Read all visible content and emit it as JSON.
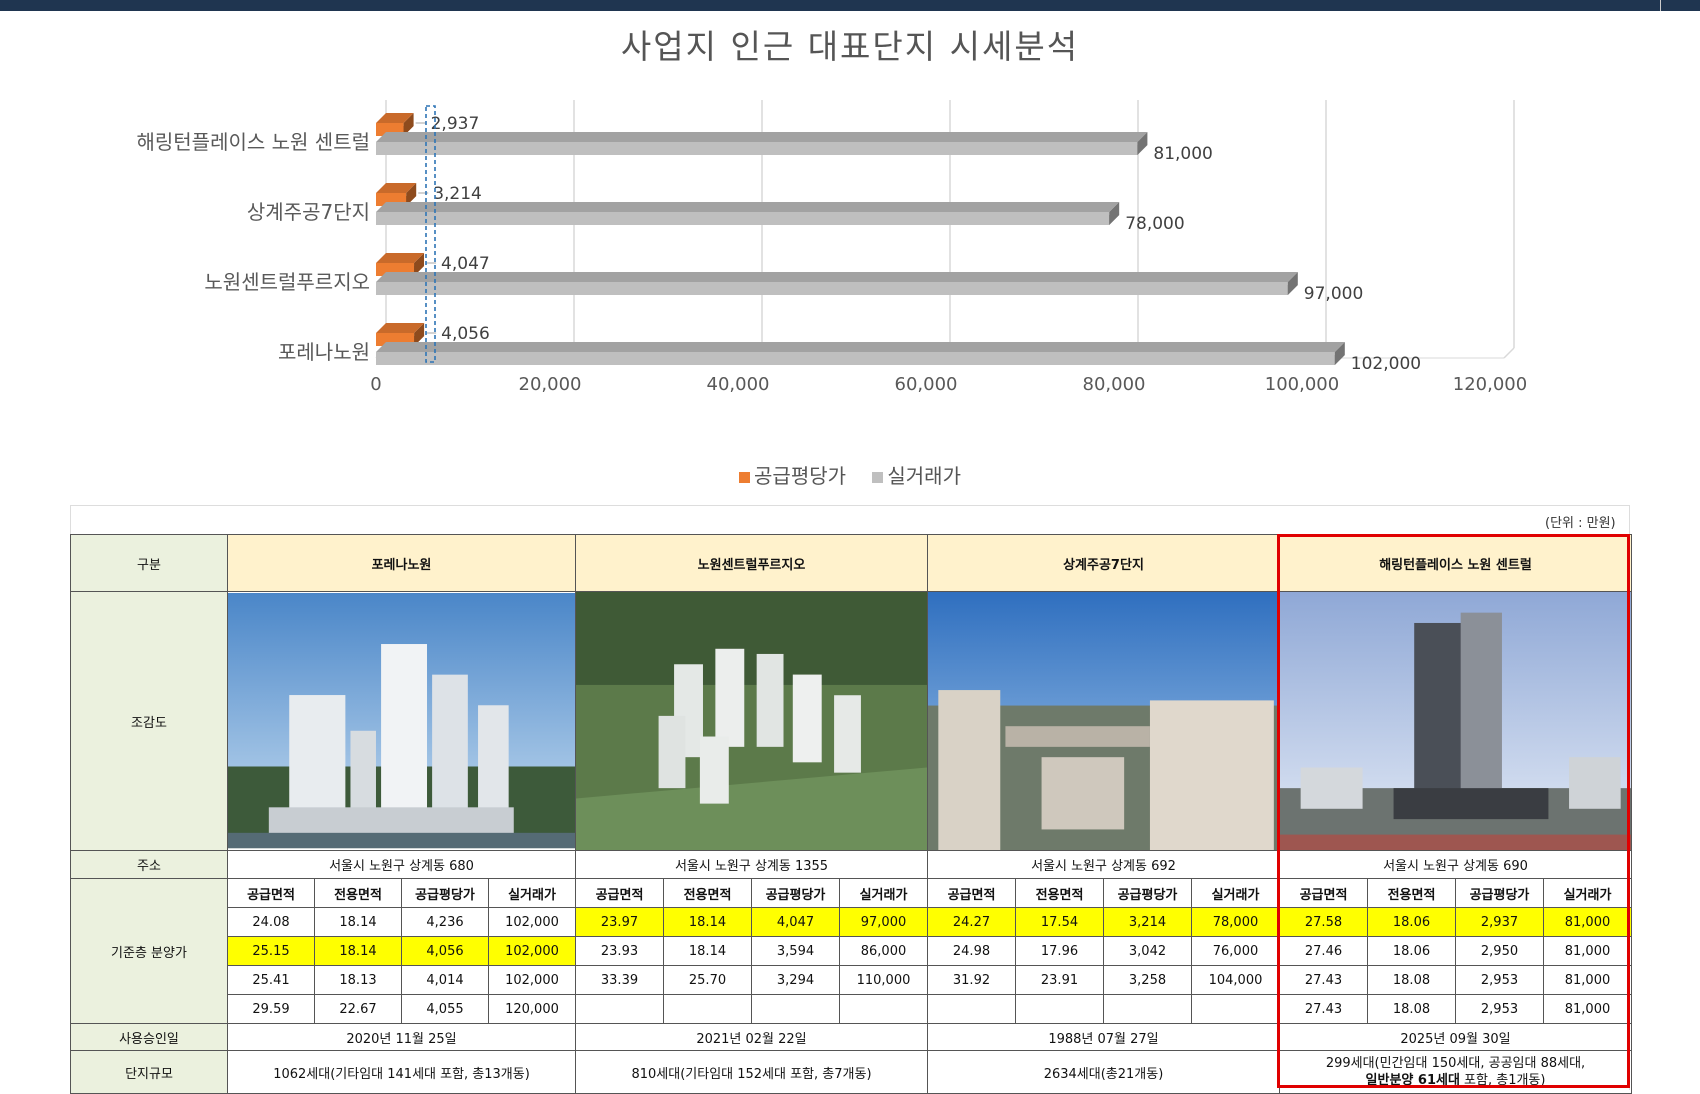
{
  "colors": {
    "supply": "#ed7d31",
    "actual": "#bfbfbf",
    "highlight": "#ffff00",
    "row_header": "#ebf1de",
    "col_header": "#fff2cc",
    "red_box": "#e00000"
  },
  "chart_data": {
    "type": "bar",
    "orientation": "horizontal",
    "title": "사업지 인근 대표단지 시세분석",
    "categories": [
      "해링턴플레이스 노원 센트럴",
      "상계주공7단지",
      "노원센트럴푸르지오",
      "포레나노원"
    ],
    "series": [
      {
        "name": "공급평당가",
        "values": [
          2937,
          3214,
          4047,
          4056
        ],
        "labels": [
          "2,937",
          "3,214",
          "4,047",
          "4,056"
        ]
      },
      {
        "name": "실거래가",
        "values": [
          81000,
          78000,
          97000,
          102000
        ],
        "labels": [
          "81,000",
          "78,000",
          "97,000",
          "102,000"
        ]
      }
    ],
    "xlim": [
      0,
      120000
    ],
    "xticks": [
      0,
      20000,
      40000,
      60000,
      80000,
      100000,
      120000
    ],
    "xtick_labels": [
      "0",
      "20,000",
      "40,000",
      "60,000",
      "80,000",
      "100,000",
      "120,000"
    ],
    "grid": true,
    "legend": "bottom"
  },
  "table": {
    "unit": "(단위 : 만원)",
    "row_labels": {
      "category": "구분",
      "view": "조감도",
      "address": "주소",
      "price": "기준층 분양가",
      "approval": "사용승인일",
      "scale": "단지규모"
    },
    "sub_headers": [
      "공급면적",
      "전용면적",
      "공급평당가",
      "실거래가"
    ],
    "complexes": [
      {
        "name": "포레나노원",
        "image_icon": "tower-building-image",
        "address": "서울시 노원구 상계동 680",
        "rows": [
          [
            "24.08",
            "18.14",
            "4,236",
            "102,000"
          ],
          [
            "25.15",
            "18.14",
            "4,056",
            "102,000"
          ],
          [
            "25.41",
            "18.13",
            "4,014",
            "102,000"
          ],
          [
            "29.59",
            "22.67",
            "4,055",
            "120,000"
          ]
        ],
        "highlight_row": 1,
        "approval": "2020년 11월 25일",
        "scale": "1062세대(기타임대 141세대 포함, 총13개동)"
      },
      {
        "name": "노원센트럴푸르지오",
        "image_icon": "aerial-complex-image",
        "address": "서울시 노원구 상계동 1355",
        "rows": [
          [
            "23.97",
            "18.14",
            "4,047",
            "97,000"
          ],
          [
            "23.93",
            "18.14",
            "3,594",
            "86,000"
          ],
          [
            "33.39",
            "25.70",
            "3,294",
            "110,000"
          ],
          [
            "",
            "",
            "",
            ""
          ]
        ],
        "highlight_row": 0,
        "approval": "2021년 02월 22일",
        "scale": "810세대(기타임대 152세대 포함, 총7개동)"
      },
      {
        "name": "상계주공7단지",
        "image_icon": "apartment-photo-image",
        "address": "서울시 노원구 상계동 692",
        "rows": [
          [
            "24.27",
            "17.54",
            "3,214",
            "78,000"
          ],
          [
            "24.98",
            "17.96",
            "3,042",
            "76,000"
          ],
          [
            "31.92",
            "23.91",
            "3,258",
            "104,000"
          ],
          [
            "",
            "",
            "",
            ""
          ]
        ],
        "highlight_row": 0,
        "approval": "1988년 07월 27일",
        "scale": "2634세대(총21개동)"
      },
      {
        "name": "해링턴플레이스 노원 센트럴",
        "image_icon": "highrise-render-image",
        "address": "서울시 노원구 상계동 690",
        "rows": [
          [
            "27.58",
            "18.06",
            "2,937",
            "81,000"
          ],
          [
            "27.46",
            "18.06",
            "2,950",
            "81,000"
          ],
          [
            "27.43",
            "18.08",
            "2,953",
            "81,000"
          ],
          [
            "27.43",
            "18.08",
            "2,953",
            "81,000"
          ]
        ],
        "highlight_row": 0,
        "approval": "2025년 09월 30일",
        "scale_line1": "299세대(민간임대 150세대, 공공임대 88세대,",
        "scale_bold": "일반분양 61세대",
        "scale_tail": " 포함, 총1개동)"
      }
    ]
  }
}
